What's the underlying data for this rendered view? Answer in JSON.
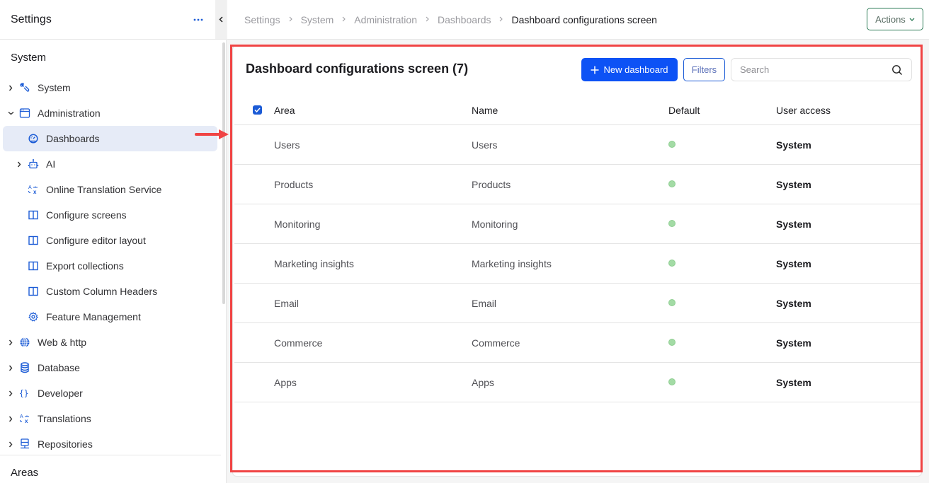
{
  "sidebar": {
    "title": "Settings",
    "more_icon": "more-horizontal-icon",
    "collapse_icon": "chevron-left-icon",
    "section_system": "System",
    "items": [
      {
        "label": "System",
        "icon": "wrench-icon",
        "expand": "collapsed",
        "level": 0
      },
      {
        "label": "Administration",
        "icon": "window-icon",
        "expand": "expanded",
        "level": 0
      },
      {
        "label": "Dashboards",
        "icon": "dashboard-gauge-icon",
        "expand": "none",
        "level": 1,
        "active": true
      },
      {
        "label": "AI",
        "icon": "robot-icon",
        "expand": "collapsed",
        "level": 1
      },
      {
        "label": "Online Translation Service",
        "icon": "translate-icon",
        "expand": "none",
        "level": 1
      },
      {
        "label": "Configure screens",
        "icon": "columns-icon",
        "expand": "none",
        "level": 1
      },
      {
        "label": "Configure editor layout",
        "icon": "columns-icon",
        "expand": "none",
        "level": 1
      },
      {
        "label": "Export collections",
        "icon": "columns-icon",
        "expand": "none",
        "level": 1
      },
      {
        "label": "Custom Column Headers",
        "icon": "columns-icon",
        "expand": "none",
        "level": 1
      },
      {
        "label": "Feature Management",
        "icon": "gear-icon",
        "expand": "none",
        "level": 1
      },
      {
        "label": "Web & http",
        "icon": "globe-icon",
        "expand": "collapsed",
        "level": 0
      },
      {
        "label": "Database",
        "icon": "database-icon",
        "expand": "collapsed",
        "level": 0
      },
      {
        "label": "Developer",
        "icon": "braces-icon",
        "expand": "collapsed",
        "level": 0
      },
      {
        "label": "Translations",
        "icon": "translate-icon",
        "expand": "collapsed",
        "level": 0
      },
      {
        "label": "Repositories",
        "icon": "server-icon",
        "expand": "collapsed",
        "level": 0
      }
    ],
    "section_areas": "Areas"
  },
  "topbar": {
    "breadcrumb": [
      "Settings",
      "System",
      "Administration",
      "Dashboards",
      "Dashboard configurations screen"
    ],
    "actions_label": "Actions"
  },
  "main": {
    "title": "Dashboard configurations screen (7)",
    "new_button_label": "New dashboard",
    "filters_label": "Filters",
    "search_placeholder": "Search",
    "search_value": "",
    "columns": [
      "Area",
      "Name",
      "Default",
      "User access"
    ],
    "select_all_checked": true,
    "rows": [
      {
        "area": "Users",
        "name": "Users",
        "default": true,
        "access": "System"
      },
      {
        "area": "Products",
        "name": "Products",
        "default": true,
        "access": "System"
      },
      {
        "area": "Monitoring",
        "name": "Monitoring",
        "default": true,
        "access": "System"
      },
      {
        "area": "Marketing insights",
        "name": "Marketing insights",
        "default": true,
        "access": "System"
      },
      {
        "area": "Email",
        "name": "Email",
        "default": true,
        "access": "System"
      },
      {
        "area": "Commerce",
        "name": "Commerce",
        "default": true,
        "access": "System"
      },
      {
        "area": "Apps",
        "name": "Apps",
        "default": true,
        "access": "System"
      }
    ]
  },
  "colors": {
    "accent": "#0d52f5",
    "icon_blue": "#1b5bd6",
    "active_bg": "#e6ebf7",
    "default_dot": "#a3dba5",
    "actions_border": "#2b7a55",
    "highlight_red": "#f04444"
  }
}
